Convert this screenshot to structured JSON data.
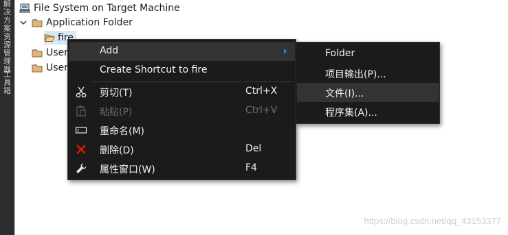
{
  "side_strip": {
    "tab1": "解决方案资源管理器",
    "tab2": "工具箱"
  },
  "tree": {
    "root": "File System on Target Machine",
    "app_folder": "Application Folder",
    "selected_item": "fire",
    "user1": "User",
    "user2": "User"
  },
  "context_menu": {
    "add": "Add",
    "create_shortcut": "Create Shortcut to fire",
    "cut": {
      "label": "剪切(T)",
      "shortcut": "Ctrl+X"
    },
    "paste": {
      "label": "粘贴(P)",
      "shortcut": "Ctrl+V"
    },
    "rename": {
      "label": "重命名(M)"
    },
    "delete": {
      "label": "删除(D)",
      "shortcut": "Del"
    },
    "properties": {
      "label": "属性窗口(W)",
      "shortcut": "F4"
    }
  },
  "submenu": {
    "folder": "Folder",
    "project_output": "项目输出(P)...",
    "file": "文件(I)...",
    "assembly": "程序集(A)..."
  },
  "watermark": "https://blog.csdn.net/qq_43153377",
  "colors": {
    "menu_bg": "#1b1b1c",
    "menu_hover": "#333334",
    "selection": "#d9e8f6",
    "delete_icon": "#e51400",
    "submenu_arrow": "#1e90ff"
  }
}
